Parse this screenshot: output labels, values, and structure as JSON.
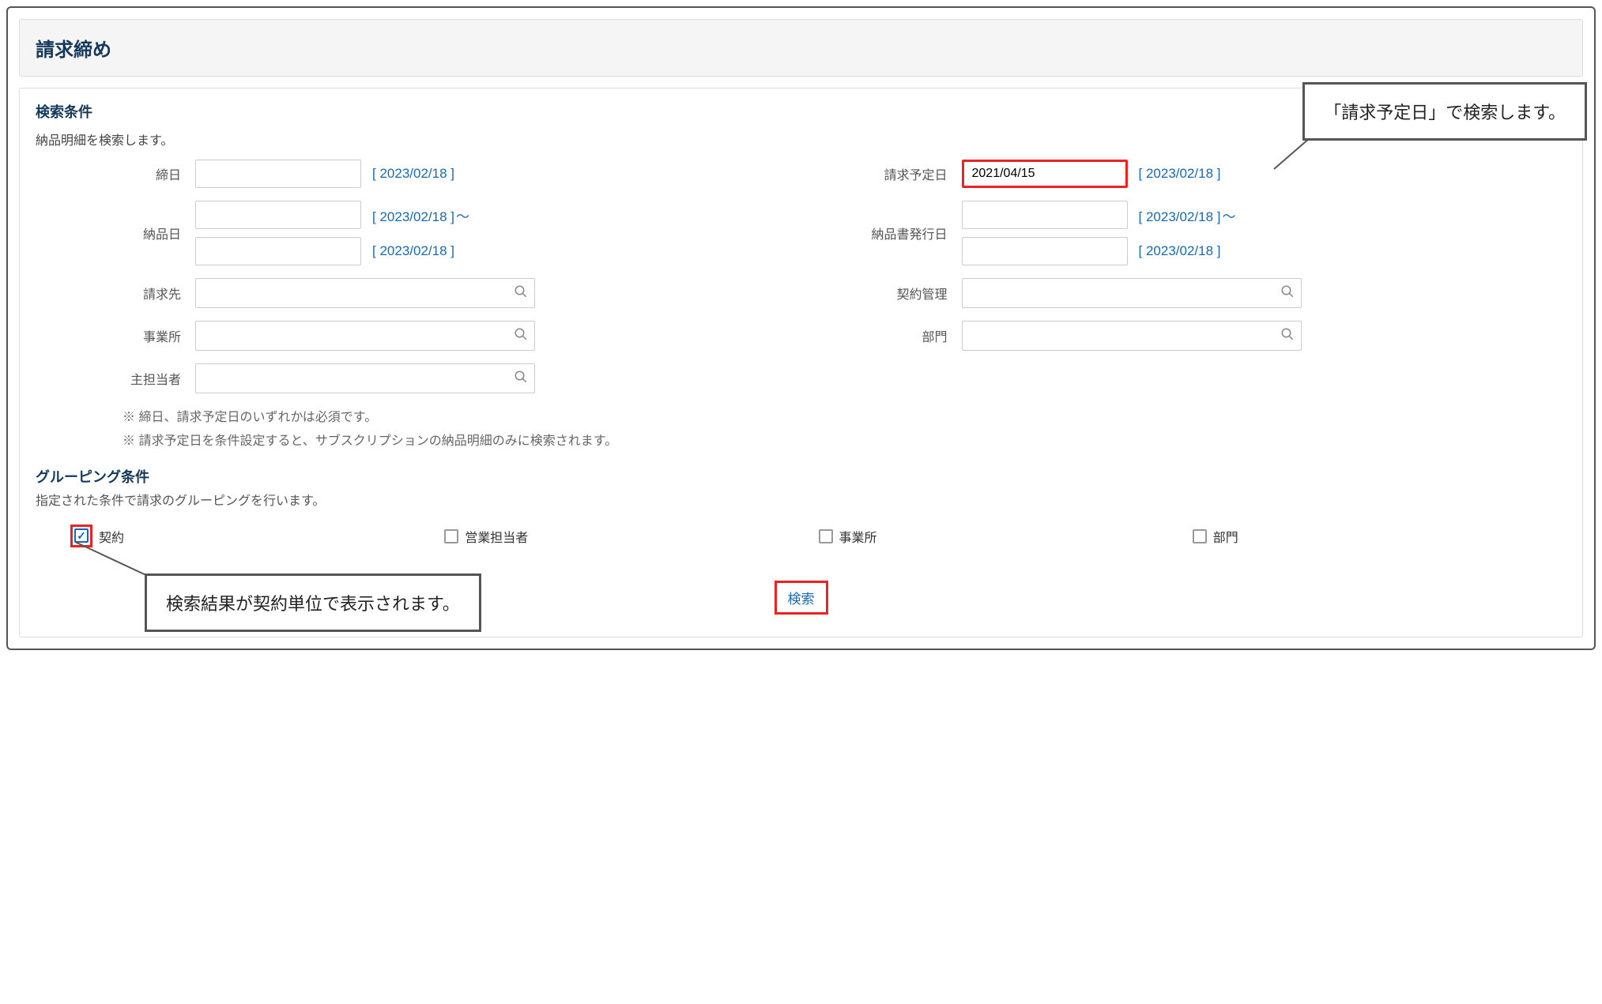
{
  "page_title": "請求締め",
  "search": {
    "section_title": "検索条件",
    "description": "納品明細を検索します。",
    "labels": {
      "closing_date": "締日",
      "delivery_date": "納品日",
      "billing_to": "請求先",
      "office": "事業所",
      "main_staff": "主担当者",
      "scheduled_bill_date": "請求予定日",
      "slip_issue_date": "納品書発行日",
      "contract_mgmt": "契約管理",
      "department": "部門"
    },
    "helper_date": "2023/02/18",
    "scheduled_bill_value": "2021/04/15",
    "closing_date_value": "",
    "delivery_date_from": "",
    "delivery_date_to": "",
    "slip_issue_from": "",
    "slip_issue_to": "",
    "billing_to_value": "",
    "office_value": "",
    "main_staff_value": "",
    "contract_mgmt_value": "",
    "department_value": ""
  },
  "notes": {
    "n1": "※ 締日、請求予定日のいずれかは必須です。",
    "n2": "※ 請求予定日を条件設定すると、サブスクリプションの納品明細のみに検索されます。"
  },
  "grouping": {
    "title": "グルーピング条件",
    "description": "指定された条件で請求のグルーピングを行います。",
    "items": {
      "contract": {
        "label": "契約",
        "checked": true
      },
      "sales_rep": {
        "label": "営業担当者",
        "checked": false
      },
      "office": {
        "label": "事業所",
        "checked": false
      },
      "department": {
        "label": "部門",
        "checked": false
      }
    }
  },
  "buttons": {
    "search": "検索"
  },
  "callouts": {
    "top_right": "「請求予定日」で検索します。",
    "bottom_left": "検索結果が契約単位で表示されます。"
  }
}
